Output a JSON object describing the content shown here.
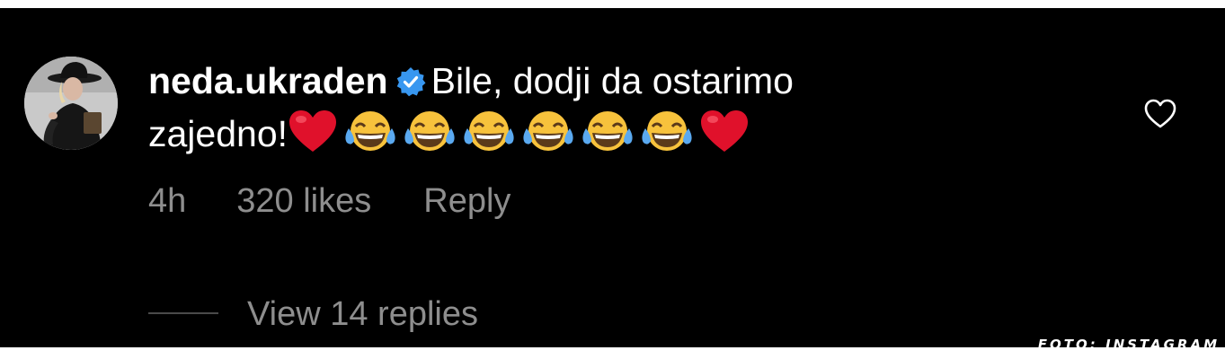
{
  "comment": {
    "username": "neda.ukraden",
    "verified": true,
    "text_line1": "Bile, dodji da ostarimo",
    "text_line2": "zajedno!",
    "emojis": [
      "red-heart",
      "tears-of-joy",
      "tears-of-joy",
      "tears-of-joy",
      "tears-of-joy",
      "tears-of-joy",
      "tears-of-joy",
      "red-heart"
    ],
    "like_icon": "heart-outline-icon"
  },
  "meta": {
    "time": "4h",
    "likes": "320 likes",
    "reply_label": "Reply"
  },
  "replies": {
    "label": "View 14 replies"
  },
  "credit": {
    "text": "FOTO: INSTAGRAM"
  },
  "colors": {
    "background": "#000000",
    "text": "#ffffff",
    "secondary_text": "#8e8e8e",
    "verified_badge": "#3897f0",
    "heart": "#e0112b"
  }
}
